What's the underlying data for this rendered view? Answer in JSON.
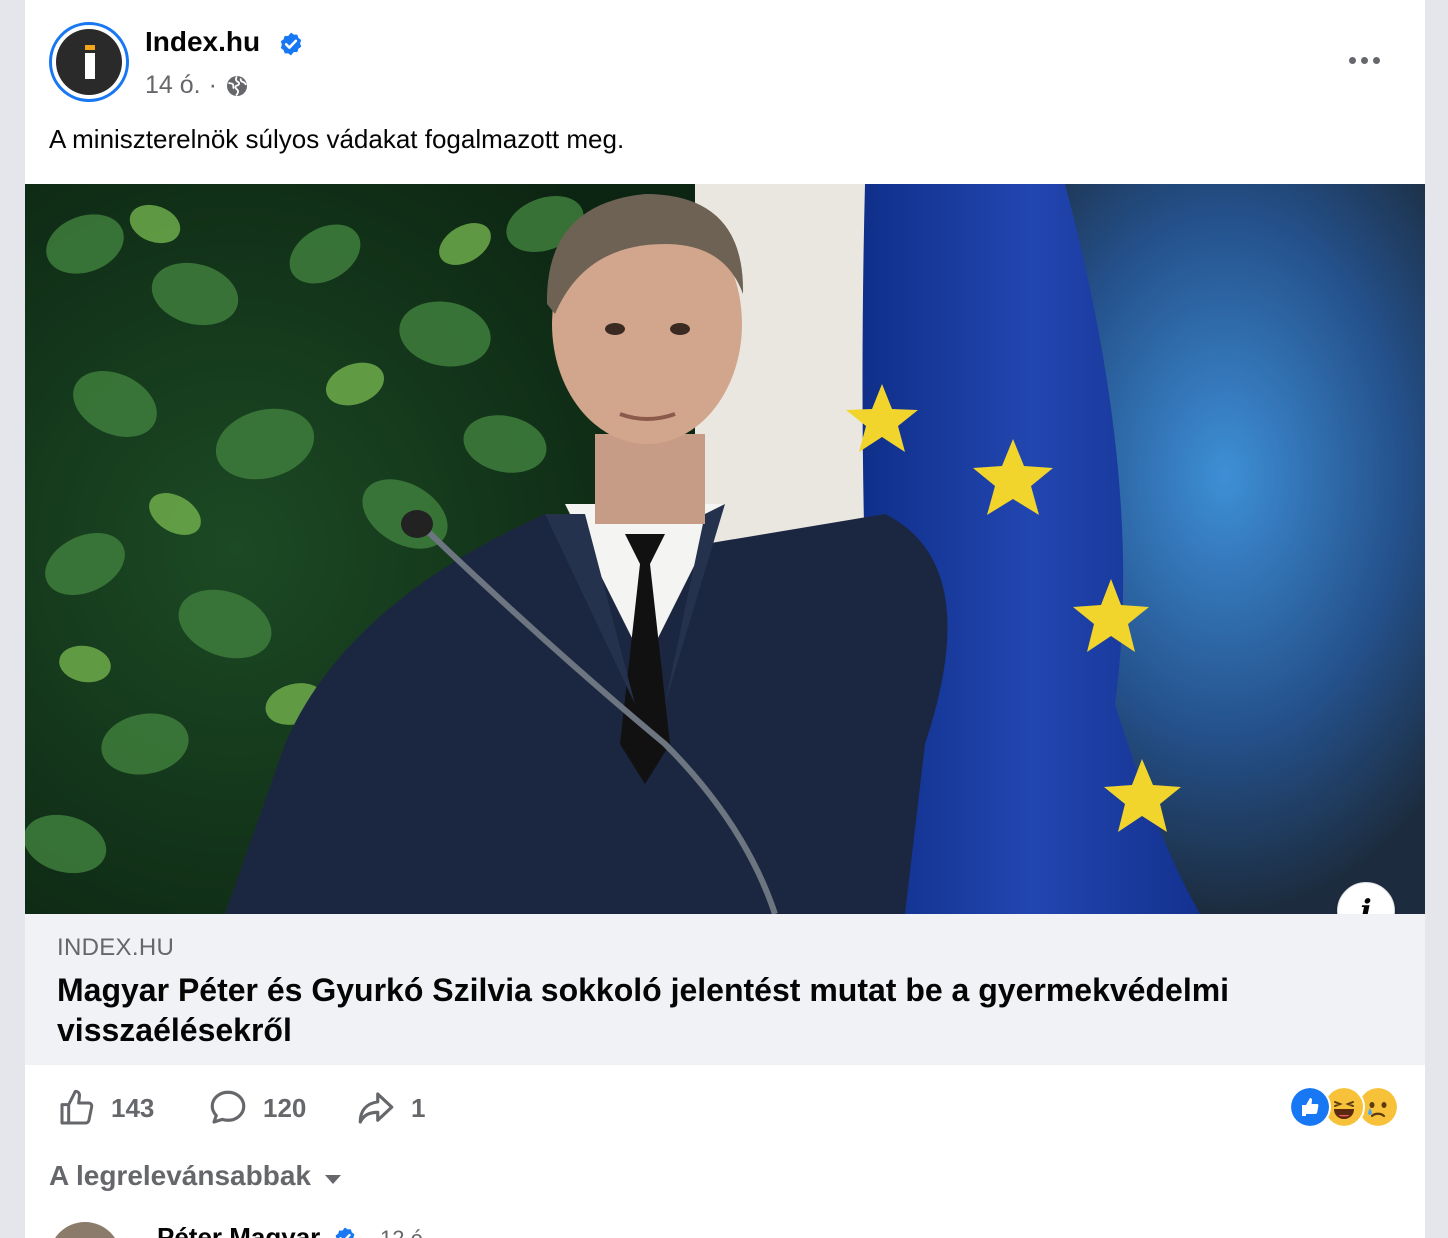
{
  "post": {
    "page_name": "Index.hu",
    "time": "14 ó.",
    "separator": "·",
    "audience_icon": "globe-icon",
    "text": "A miniszterelnök súlyos vádakat fogalmazott meg."
  },
  "link_preview": {
    "domain": "INDEX.HU",
    "title": "Magyar Péter és Gyurkó Szilvia sokkoló jelentést mutat be a gyermekvédelmi visszaélésekről"
  },
  "actions": {
    "likes": "143",
    "comments": "120",
    "shares": "1"
  },
  "reactions": [
    "like",
    "haha",
    "sad"
  ],
  "comments_section": {
    "sort_label": "A legrelevánsabbak",
    "first_comment_author": "Péter Magyar",
    "first_comment_time": "12 ó."
  },
  "colors": {
    "accent": "#1877f2",
    "secondary_text": "#65676b",
    "link_box_bg": "#f0f2f5"
  }
}
